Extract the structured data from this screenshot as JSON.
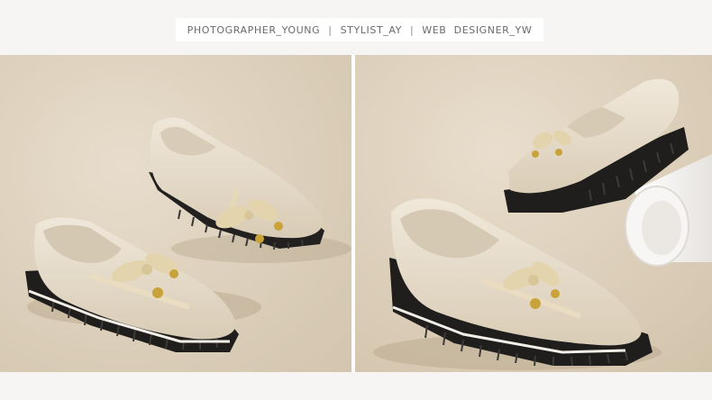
{
  "credits": {
    "photographer": "PHOTOGRAPHER_YOUNG",
    "stylist": "STYLIST_AY",
    "designer": "WEB  DESIGNER_YW",
    "separator": "|"
  },
  "colors": {
    "background": "#f6f5f3",
    "backdrop": "#e1d5c3",
    "shoe_upper": "#e8dfcf",
    "sole": "#1f1e1c",
    "bow": "#e3d3ac",
    "gold": "#c9a339"
  },
  "images": [
    {
      "name": "pair-of-loafers-front-view"
    },
    {
      "name": "loafer-side-view-with-white-prop"
    }
  ]
}
